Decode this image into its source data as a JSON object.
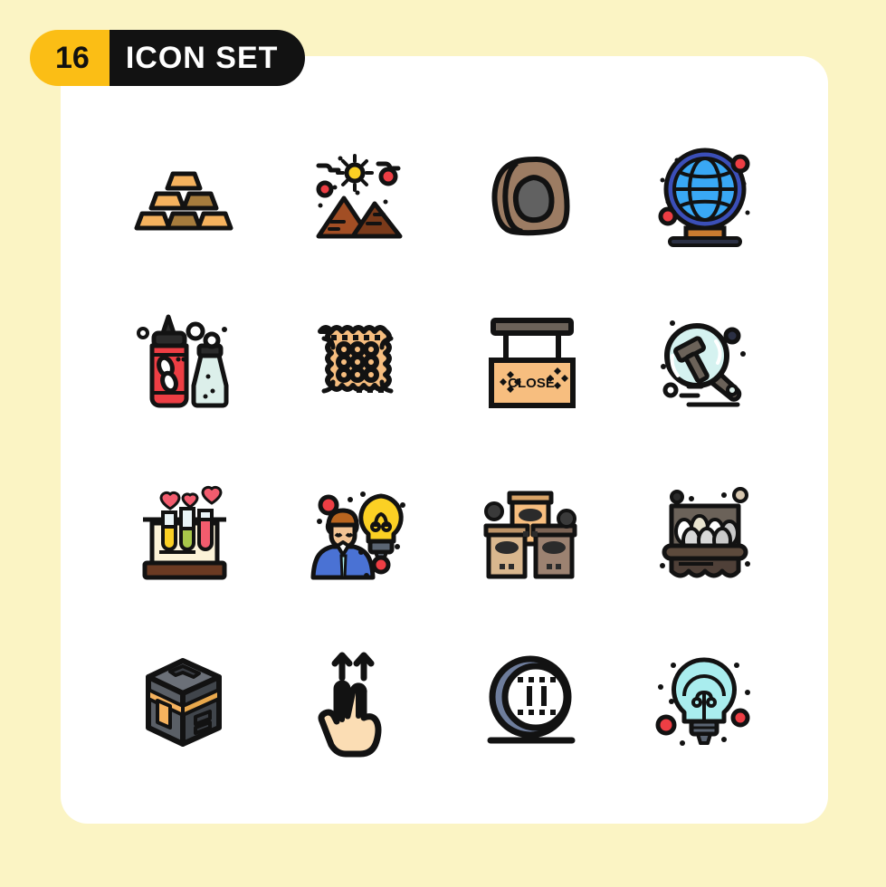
{
  "background_color": "#FBF4C4",
  "card_color": "#FFFFFF",
  "badge": {
    "count": "16",
    "label": "ICON SET",
    "count_bg": "#FBBE15",
    "count_fg": "#111111",
    "label_bg": "#121212",
    "label_fg": "#FFFFFF"
  },
  "palette": {
    "outline": "#121212",
    "gold": "#F5B25E",
    "gold_dark": "#A67C3D",
    "brick": "#A24E24",
    "brick_dark": "#7A3A1A",
    "red": "#ED3E44",
    "blue": "#3B4FB8",
    "sky": "#39A8F5",
    "sky_light": "#7FC9F9",
    "cyan": "#A9EDEE",
    "yellow": "#FBD024",
    "tan": "#F7BE7F",
    "stone": "#9C7C63",
    "stone_core": "#616161",
    "gray_blue": "#6E7D9C",
    "skin": "#F7D7B0",
    "brown": "#6B4A33"
  },
  "grid": {
    "columns": 4,
    "rows": 4,
    "total": 16
  },
  "icons": [
    {
      "position": 1,
      "name": "gold-bars-icon",
      "label": "Gold Bars"
    },
    {
      "position": 2,
      "name": "pyramids-icon",
      "label": "Pyramids"
    },
    {
      "position": 3,
      "name": "stone-rock-icon",
      "label": "Stone"
    },
    {
      "position": 4,
      "name": "globe-stand-icon",
      "label": "Globe"
    },
    {
      "position": 5,
      "name": "ketchup-salt-icon",
      "label": "Ketchup and Salt"
    },
    {
      "position": 6,
      "name": "biscuit-cracker-icon",
      "label": "Biscuit"
    },
    {
      "position": 7,
      "name": "close-sign-icon",
      "label": "Close Sign",
      "text": "CLOSE"
    },
    {
      "position": 8,
      "name": "gavel-search-icon",
      "label": "Law Search"
    },
    {
      "position": 9,
      "name": "test-tube-rack-icon",
      "label": "Test Tubes"
    },
    {
      "position": 10,
      "name": "businessman-idea-icon",
      "label": "Businessman Idea"
    },
    {
      "position": 11,
      "name": "boxes-stack-icon",
      "label": "Boxes"
    },
    {
      "position": 12,
      "name": "egg-carton-icon",
      "label": "Egg Carton"
    },
    {
      "position": 13,
      "name": "kaaba-icon",
      "label": "Kaaba"
    },
    {
      "position": 14,
      "name": "two-finger-swipe-up-icon",
      "label": "Two Finger Swipe Up"
    },
    {
      "position": 15,
      "name": "tire-icon",
      "label": "Tire"
    },
    {
      "position": 16,
      "name": "light-bulb-icon",
      "label": "Light Bulb"
    }
  ]
}
